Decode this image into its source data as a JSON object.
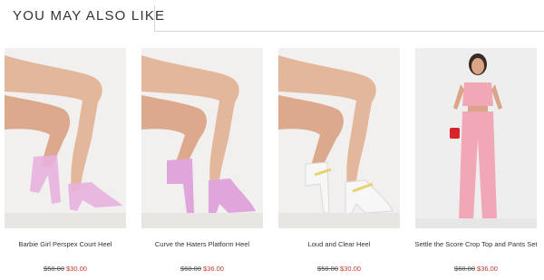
{
  "section": {
    "title": "YOU MAY ALSO LIKE"
  },
  "products": [
    {
      "name": "Barbie Girl Perspex Court Heel",
      "old_price": "$50.00",
      "new_price": "$30.00",
      "image": "pink-perspex-court-heels"
    },
    {
      "name": "Curve the Haters Platform Heel",
      "old_price": "$60.00",
      "new_price": "$36.00",
      "image": "pink-platform-heels"
    },
    {
      "name": "Loud and Clear Heel",
      "old_price": "$50.00",
      "new_price": "$30.00",
      "image": "clear-white-heels"
    },
    {
      "name": "Settle the Score Crop Top and Pants Set",
      "old_price": "$60.00",
      "new_price": "$36.00",
      "image": "pink-crop-top-pants-set"
    }
  ],
  "colors": {
    "sale_price": "#c0392b",
    "divider": "#d7d7d7",
    "pink": "#e7a9d8"
  }
}
